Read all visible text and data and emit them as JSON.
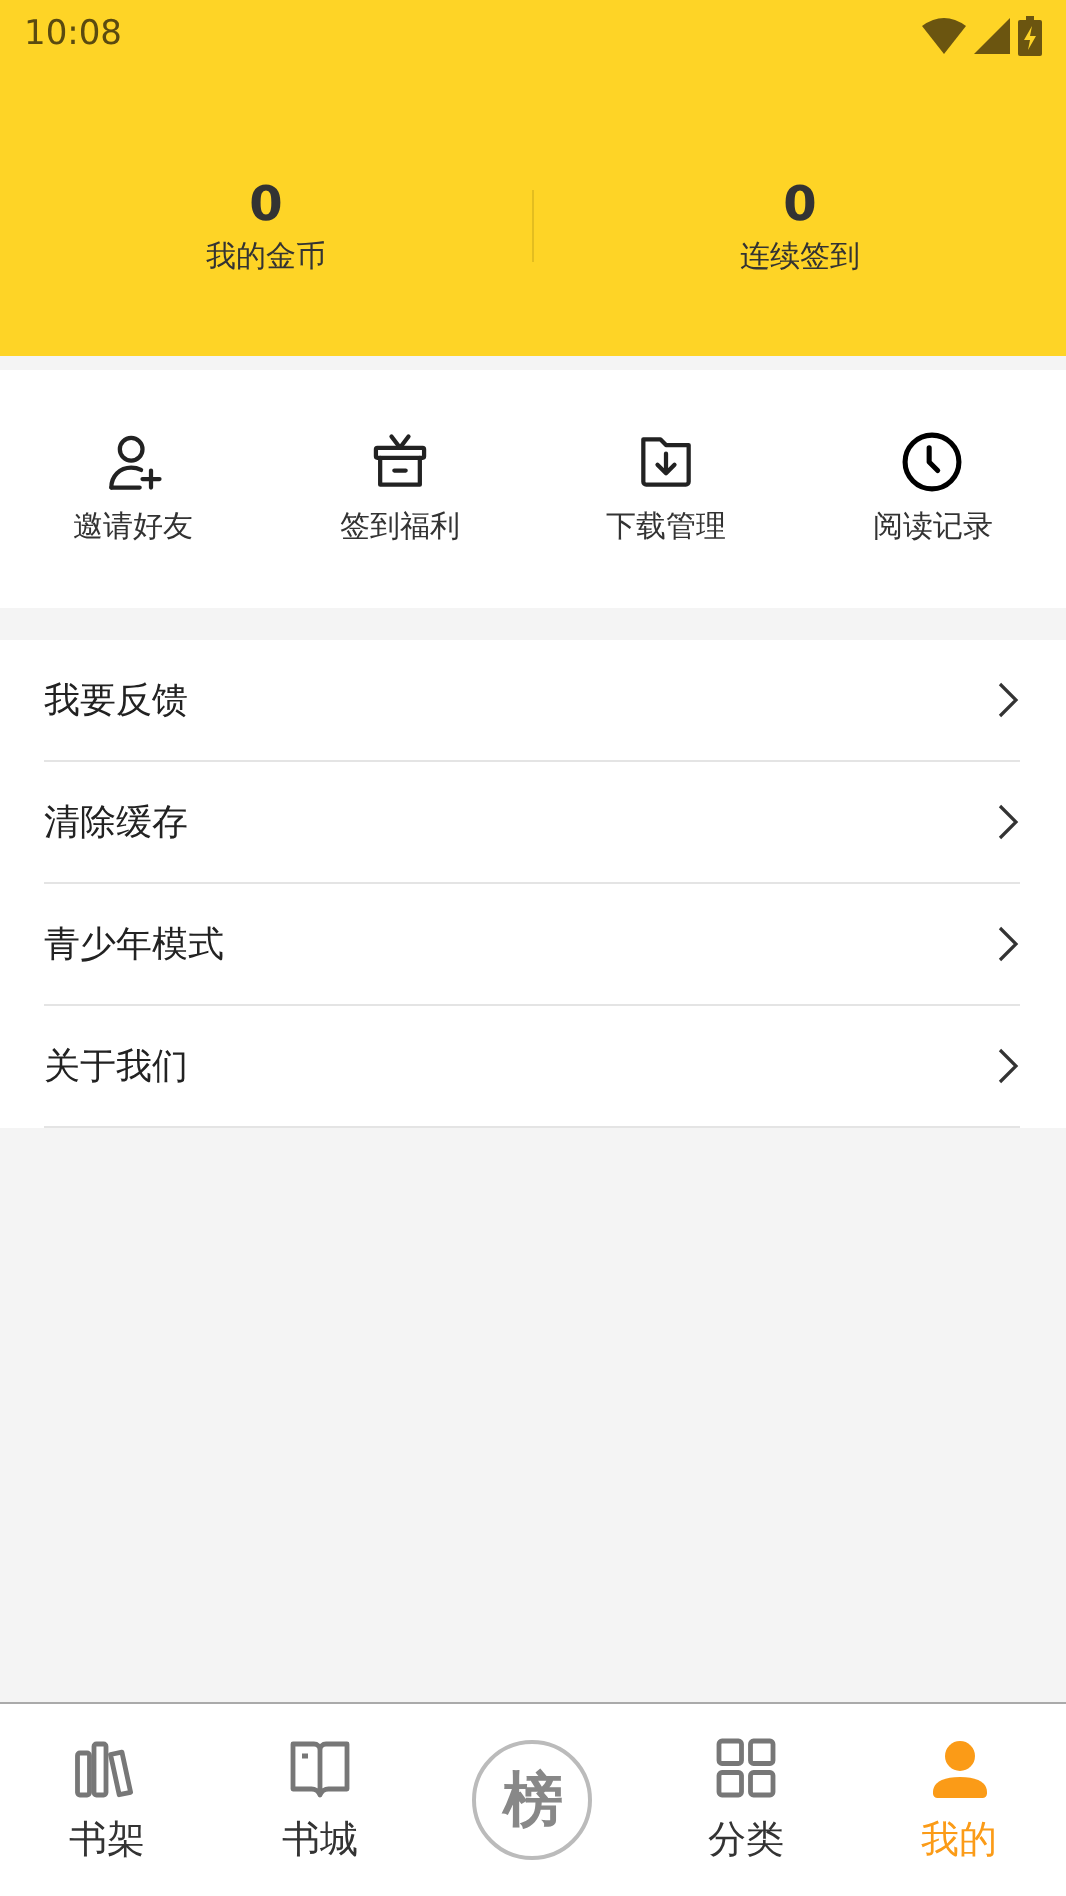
{
  "status_bar": {
    "time": "10:08"
  },
  "stats": [
    {
      "value": "0",
      "label": "我的金币"
    },
    {
      "value": "0",
      "label": "连续签到"
    }
  ],
  "shortcuts": [
    {
      "label": "邀请好友"
    },
    {
      "label": "签到福利"
    },
    {
      "label": "下载管理"
    },
    {
      "label": "阅读记录"
    }
  ],
  "menu": [
    {
      "label": "我要反馈"
    },
    {
      "label": "清除缓存"
    },
    {
      "label": "青少年模式"
    },
    {
      "label": "关于我们"
    }
  ],
  "tab_bar": [
    {
      "kind": "tab",
      "label": "书架",
      "selected": false
    },
    {
      "kind": "tab",
      "label": "书城",
      "selected": false
    },
    {
      "kind": "center",
      "glyph": "榜",
      "selected": false
    },
    {
      "kind": "tab",
      "label": "分类",
      "selected": false
    },
    {
      "kind": "tab",
      "label": "我的",
      "selected": true
    }
  ]
}
